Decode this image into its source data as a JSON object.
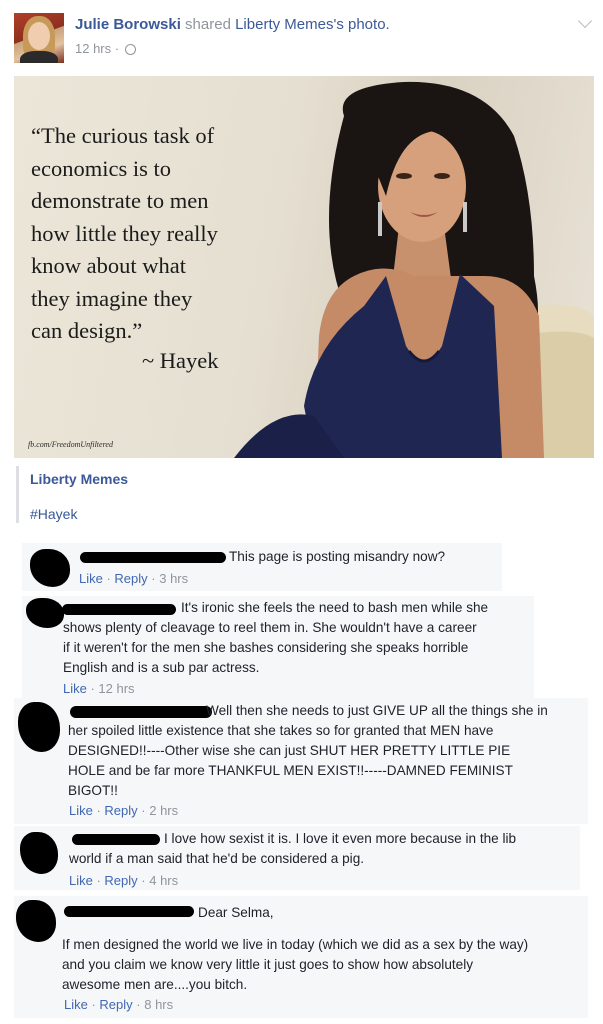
{
  "post": {
    "author": "Julie Borowski",
    "action": "shared",
    "page_possessive": "Liberty Memes's",
    "object": "photo.",
    "time": "12 hrs",
    "separator": "·"
  },
  "photo": {
    "quote_lines": [
      "“The curious task of",
      "economics is to",
      "demonstrate to men",
      "how little they really",
      "know about what",
      "they imagine they",
      "can design.”"
    ],
    "attribution": "~ Hayek",
    "watermark": "fb.com/FreedomUnfiltered"
  },
  "shared_page": {
    "name": "Liberty Memes",
    "hashtag": "#Hayek"
  },
  "comments": [
    {
      "lines": [
        "This page is posting misandry now?"
      ],
      "actions": [
        "Like",
        "Reply"
      ],
      "time": "3 hrs"
    },
    {
      "lines": [
        "It's ironic she feels the need to bash men while she",
        "shows plenty of cleavage to reel them in. She wouldn't have a career",
        "if it weren't for the men she bashes considering she speaks horrible",
        "English and is a sub par actress."
      ],
      "actions": [
        "Like"
      ],
      "time": "12 hrs"
    },
    {
      "lines": [
        "Well then she needs to just GIVE UP all the things she in",
        "her spoiled little existence that she takes so for granted that MEN have",
        "DESIGNED!!----Other wise she can just SHUT HER PRETTY LITTLE PIE",
        "HOLE and be far more THANKFUL MEN EXIST!!-----DAMNED FEMINIST",
        "BIGOT!!"
      ],
      "actions": [
        "Like",
        "Reply"
      ],
      "time": "2 hrs"
    },
    {
      "lines": [
        "I love how sexist it is. I love it even more because in the lib",
        "world if a man said that he'd be considered a pig."
      ],
      "actions": [
        "Like",
        "Reply"
      ],
      "time": "4 hrs"
    },
    {
      "lines": [
        "Dear Selma,",
        "",
        "If men designed the world we live in today (which we did as a sex by the way)",
        "and you claim we know very little it just goes to show how absolutely",
        "awesome men are....you bitch."
      ],
      "actions": [
        "Like",
        "Reply"
      ],
      "time": "8 hrs"
    }
  ],
  "colors": {
    "link": "#3b5998",
    "muted": "#90949c",
    "comment_bg": "#f6f7f9",
    "text": "#1d2129"
  }
}
